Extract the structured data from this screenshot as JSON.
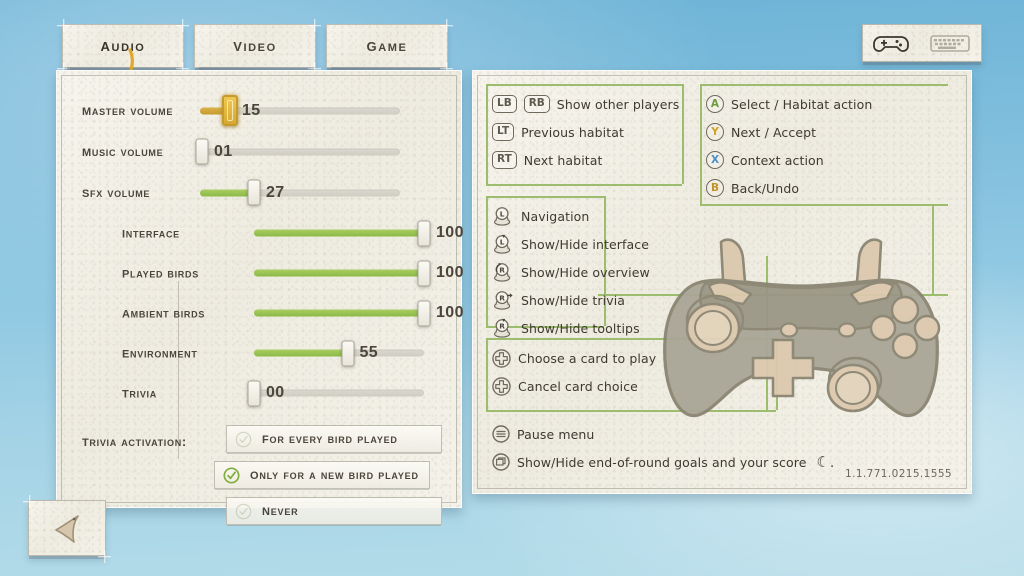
{
  "window": {
    "version": "1.1.771.0215.1555",
    "background_color": "#8fc8e2",
    "paper_color": "#f3f1e8",
    "accent_green": "#8cba46",
    "accent_gold": "#d7a92f",
    "bracket_green": "#9dbd6e"
  },
  "tabs": [
    {
      "label": "Audio",
      "active": true,
      "name": "tab-audio"
    },
    {
      "label": "Video",
      "active": false,
      "name": "tab-video"
    },
    {
      "label": "Game",
      "active": false,
      "name": "tab-game"
    }
  ],
  "device_toggle": {
    "controller_icon": "gamepad-icon",
    "keyboard_icon": "keyboard-icon",
    "selected": "controller"
  },
  "back_button": {
    "icon": "back-arrow-icon"
  },
  "audio": {
    "sliders": [
      {
        "label": "Master volume",
        "value": "15",
        "percent": 15,
        "focused": true,
        "indent": false
      },
      {
        "label": "Music volume",
        "value": "01",
        "percent": 1,
        "focused": false,
        "indent": false
      },
      {
        "label": "SFX volume",
        "value": "27",
        "percent": 27,
        "focused": false,
        "indent": false
      },
      {
        "label": "Interface",
        "value": "100",
        "percent": 100,
        "focused": false,
        "indent": true
      },
      {
        "label": "Played birds",
        "value": "100",
        "percent": 100,
        "focused": false,
        "indent": true
      },
      {
        "label": "Ambient birds",
        "value": "100",
        "percent": 100,
        "focused": false,
        "indent": true
      },
      {
        "label": "Environment",
        "value": "55",
        "percent": 55,
        "focused": false,
        "indent": true
      },
      {
        "label": "Trivia",
        "value": "00",
        "percent": 0,
        "focused": false,
        "indent": true
      }
    ],
    "trivia_activation": {
      "label": "Trivia activation:",
      "options": [
        {
          "label": "For every bird played",
          "selected": false
        },
        {
          "label": "Only for a new bird played",
          "selected": true
        },
        {
          "label": "Never",
          "selected": false
        }
      ]
    }
  },
  "controls": {
    "groups": [
      {
        "name": "shoulder-triggers-group",
        "items": [
          {
            "buttons": [
              "LB",
              "RB"
            ],
            "type": "pill",
            "label": "Show other players"
          },
          {
            "buttons": [
              "LT"
            ],
            "type": "pill",
            "label": "Previous habitat"
          },
          {
            "buttons": [
              "RT"
            ],
            "type": "pill",
            "label": "Next habitat"
          }
        ]
      },
      {
        "name": "face-buttons-group",
        "items": [
          {
            "buttons": [
              "A"
            ],
            "type": "round",
            "color": "a",
            "label": "Select / Habitat action"
          },
          {
            "buttons": [
              "Y"
            ],
            "type": "round",
            "color": "y",
            "label": "Next / Accept"
          },
          {
            "buttons": [
              "X"
            ],
            "type": "round",
            "color": "x",
            "label": "Context action"
          },
          {
            "buttons": [
              "B"
            ],
            "type": "round",
            "color": "b",
            "label": "Back/Undo"
          }
        ]
      },
      {
        "name": "analog-sticks-group",
        "items": [
          {
            "buttons": [
              "L"
            ],
            "type": "stick",
            "arrow": "none",
            "label": "Navigation"
          },
          {
            "buttons": [
              "L"
            ],
            "type": "stick",
            "arrow": "press",
            "label": "Show/Hide interface"
          },
          {
            "buttons": [
              "R"
            ],
            "type": "stick",
            "arrow": "left",
            "label": "Show/Hide overview"
          },
          {
            "buttons": [
              "R"
            ],
            "type": "stick",
            "arrow": "right",
            "label": "Show/Hide trivia"
          },
          {
            "buttons": [
              "R"
            ],
            "type": "stick",
            "arrow": "press",
            "label": "Show/Hide tooltips"
          }
        ]
      },
      {
        "name": "dpad-group",
        "items": [
          {
            "buttons": [
              "dpad"
            ],
            "type": "dpad",
            "label": "Choose a card to play"
          },
          {
            "buttons": [
              "dpad"
            ],
            "type": "dpad",
            "label": "Cancel card choice"
          }
        ]
      },
      {
        "name": "system-buttons-group",
        "items": [
          {
            "buttons": [
              "menu"
            ],
            "type": "menu",
            "label": "Pause menu"
          },
          {
            "buttons": [
              "view"
            ],
            "type": "view",
            "label": "Show/Hide end-of-round goals and your score"
          }
        ]
      }
    ]
  }
}
